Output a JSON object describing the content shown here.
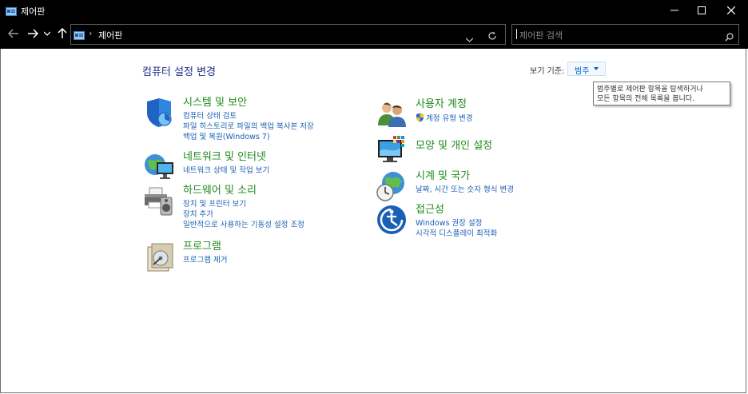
{
  "window": {
    "title": "제어판"
  },
  "address": {
    "crumb": "제어판"
  },
  "search": {
    "placeholder": "제어판 검색"
  },
  "main": {
    "heading": "컴퓨터 설정 변경",
    "view_by_label": "보기 기준:",
    "view_by_value": "범주",
    "tooltip_line1": "범주별로 제어판 항목을 탐색하거나",
    "tooltip_line2": "모든 항목의 전체 목록을 봅니다."
  },
  "categories_left": [
    {
      "title": "시스템 및 보안",
      "icon": "shield-icon",
      "links": [
        "컴퓨터 상태 검토",
        "파일 히스토리로 파일의 백업 복사본 저장",
        "백업 및 복원(Windows 7)"
      ]
    },
    {
      "title": "네트워크 및 인터넷",
      "icon": "network-globe-icon",
      "links": [
        "네트워크 상태 및 작업 보기"
      ]
    },
    {
      "title": "하드웨어 및 소리",
      "icon": "printer-speaker-icon",
      "links": [
        "장치 및 프린터 보기",
        "장치 추가",
        "일반적으로 사용하는 기동성 설정 조정"
      ]
    },
    {
      "title": "프로그램",
      "icon": "programs-icon",
      "links": [
        "프로그램 제거"
      ]
    }
  ],
  "categories_right": [
    {
      "title": "사용자 계정",
      "icon": "users-icon",
      "links": [
        "계정 유형 변경"
      ]
    },
    {
      "title": "모양 및 개인 설정",
      "icon": "monitor-palette-icon",
      "links": []
    },
    {
      "title": "시계 및 국가",
      "icon": "clock-globe-icon",
      "links": [
        "날짜, 시간 또는 숫자 형식 변경"
      ]
    },
    {
      "title": "접근성",
      "icon": "ease-of-access-icon",
      "links": [
        "Windows 권장 설정",
        "시각적 디스플레이 최적화"
      ]
    }
  ],
  "colors": {
    "category_title": "#1e8a1e",
    "link": "#1a5fb4",
    "heading": "#1e3287",
    "titlebar": "#000000"
  }
}
